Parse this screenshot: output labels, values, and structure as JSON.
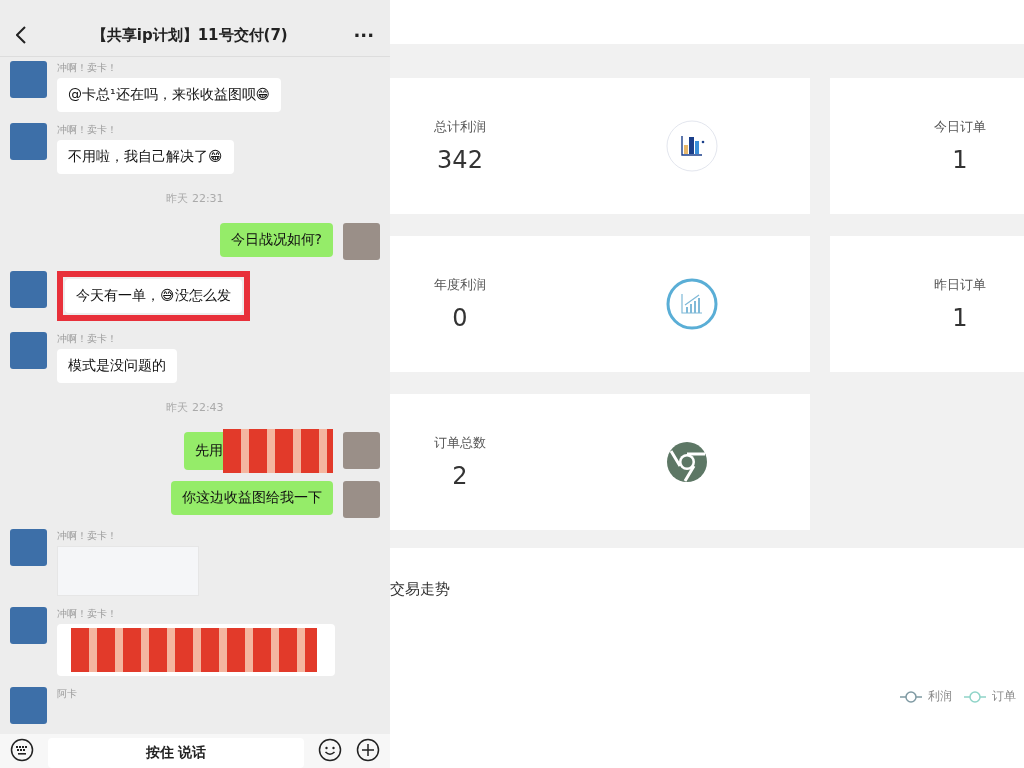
{
  "chat": {
    "title": "【共享ip计划】11号交付(7)",
    "more": "···",
    "messages": [
      {
        "kind": "in_text",
        "sender": "冲啊！卖卡！",
        "text": "@卡总¹还在吗，来张收益图呗😁",
        "highlighted": false
      },
      {
        "kind": "in_text",
        "sender": "冲啊！卖卡！",
        "text": "不用啦，我自己解决了😁",
        "highlighted": false
      },
      {
        "kind": "time",
        "text": "昨天 22:31"
      },
      {
        "kind": "out_text",
        "text": "今日战况如何?",
        "highlighted": false
      },
      {
        "kind": "in_text",
        "text": "今天有一单，😅没怎么发",
        "highlighted": true
      },
      {
        "kind": "in_text",
        "sender": "冲啊！卖卡！",
        "text": "模式是没问题的",
        "highlighted": false
      },
      {
        "kind": "time",
        "text": "昨天 22:43"
      },
      {
        "kind": "out_sticker",
        "text": "先用",
        "highlighted": false
      },
      {
        "kind": "out_text",
        "text": "你这边收益图给我一下",
        "highlighted": false
      },
      {
        "kind": "in_image",
        "sender": "冲啊！卖卡！",
        "highlighted": false
      },
      {
        "kind": "in_sticker",
        "sender": "冲啊！卖卡！",
        "highlighted": false
      },
      {
        "kind": "in_empty",
        "sender": "阿卡"
      }
    ],
    "voice_button": "按住 说话"
  },
  "dashboard": {
    "stats": [
      {
        "label": "总计利润",
        "value": "342",
        "kind": "bars"
      },
      {
        "label": "今日订单",
        "value": "1",
        "kind": "plain"
      },
      {
        "label": "年度利润",
        "value": "0",
        "kind": "growth"
      },
      {
        "label": "昨日订单",
        "value": "1",
        "kind": "plain"
      },
      {
        "label": "订单总数",
        "value": "2",
        "kind": "ring"
      }
    ],
    "chart": {
      "title": "交易走势",
      "legend": [
        {
          "label": "利润",
          "color": "#7f9aa3"
        },
        {
          "label": "订单",
          "color": "#8fd4c8"
        }
      ]
    }
  }
}
